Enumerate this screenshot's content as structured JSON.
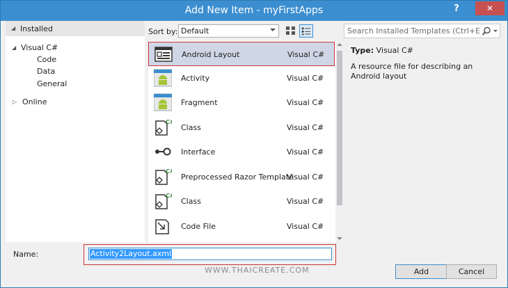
{
  "window": {
    "title": "Add New Item - myFirstApps",
    "help": "?",
    "close": "✕"
  },
  "tree": {
    "header": "Installed",
    "root": "Visual C#",
    "children": [
      "Code",
      "Data",
      "General"
    ],
    "online": "Online"
  },
  "toolbar": {
    "sort_label": "Sort by:",
    "sort_value": "Default"
  },
  "templates": [
    {
      "name": "Android Layout",
      "lang": "Visual C#",
      "icon": "android-layout-icon",
      "selected": true
    },
    {
      "name": "Activity",
      "lang": "Visual C#",
      "icon": "android-activity-icon"
    },
    {
      "name": "Fragment",
      "lang": "Visual C#",
      "icon": "android-fragment-icon"
    },
    {
      "name": "Class",
      "lang": "Visual C#",
      "icon": "csharp-class-icon"
    },
    {
      "name": "Interface",
      "lang": "Visual C#",
      "icon": "interface-icon"
    },
    {
      "name": "Preprocessed Razor Template",
      "lang": "Visual C#",
      "icon": "csharp-class-icon"
    },
    {
      "name": "Class",
      "lang": "Visual C#",
      "icon": "csharp-class-icon"
    },
    {
      "name": "Code File",
      "lang": "Visual C#",
      "icon": "code-file-icon"
    }
  ],
  "search": {
    "placeholder": "Search Installed Templates (Ctrl+E)"
  },
  "details": {
    "type_label": "Type:",
    "type_value": "Visual C#",
    "description": "A resource file for describing an Android layout"
  },
  "footer": {
    "name_label": "Name:",
    "name_value": "Activity2Layout.axml",
    "watermark": "WWW.THAICREATE.COM",
    "add": "Add",
    "cancel": "Cancel"
  },
  "colors": {
    "titlebar": "#3b8ed0",
    "close": "#c75050",
    "selection": "#cfd6e5",
    "highlight": "#cc3333",
    "android_green": "#a4c639"
  }
}
